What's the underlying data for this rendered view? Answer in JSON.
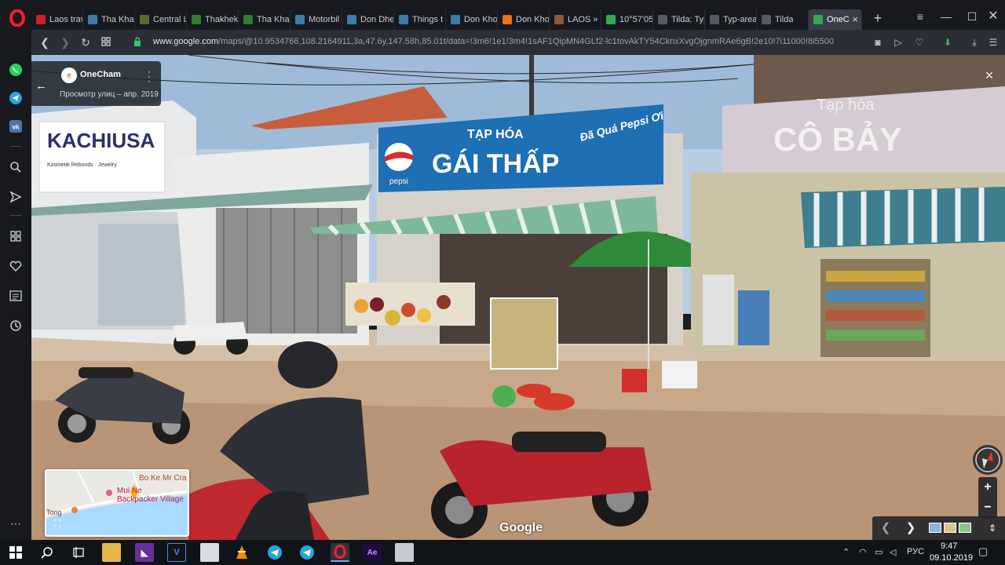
{
  "browser": {
    "tabs": [
      {
        "label": "Laos trav",
        "favicon": "opera-icon",
        "color": "#cc1f2f"
      },
      {
        "label": "Tha Khae",
        "favicon": "tripadvisor-icon",
        "color": "#3d7ea6"
      },
      {
        "label": "Central L",
        "favicon": "dm-icon",
        "color": "#5a6a2f"
      },
      {
        "label": "Thakhek",
        "favicon": "leaf-icon",
        "color": "#2e7d32"
      },
      {
        "label": "Tha Khae",
        "favicon": "leaf-icon",
        "color": "#2e7d32"
      },
      {
        "label": "Motorbil",
        "favicon": "tripadvisor-icon",
        "color": "#3d7ea6"
      },
      {
        "label": "Don Dhe",
        "favicon": "tripadvisor-icon",
        "color": "#3d7ea6"
      },
      {
        "label": "Things t",
        "favicon": "tripadvisor-icon",
        "color": "#3d7ea6"
      },
      {
        "label": "Don Kho",
        "favicon": "tripadvisor-icon",
        "color": "#3d7ea6"
      },
      {
        "label": "Don Kho",
        "favicon": "orange-circle-icon",
        "color": "#e8711a"
      },
      {
        "label": "LAOS » I",
        "favicon": "person-icon",
        "color": "#8e5a3a"
      },
      {
        "label": "10°57'05",
        "favicon": "google-maps-icon",
        "color": "#34a853"
      },
      {
        "label": "Tilda: Typ",
        "favicon": "tilda-icon",
        "color": "#555a63"
      },
      {
        "label": "Typ-area",
        "favicon": "tilda-icon",
        "color": "#555a63"
      },
      {
        "label": "Tilda",
        "favicon": "tilda-icon",
        "color": "#555a63"
      },
      {
        "label": "OneC",
        "favicon": "google-maps-icon",
        "color": "#34a853",
        "active": true
      }
    ],
    "new_tab": "+",
    "url_host": "www.google.com",
    "url_path": "/maps/@10.9534766,108.2164911,3a,47.6y,147.58h,85.01t/data=!3m6!1e1!3m4!1sAF1QipMN4GLf2-lc1tovAkTY54CknxXvgOjgnmRAe6gB!2e10!7i11000!8i5500"
  },
  "streetview": {
    "place_title": "OneCham",
    "place_subtitle": "Просмотр улиц – апр. 2019",
    "logo_letter": "e",
    "back_arrow": "←",
    "close": "×",
    "minimap": {
      "label_top": "Bo Ke Mr Cra",
      "label_place_1": "Mui Ne",
      "label_place_2": "Backpacker Village",
      "label_left": "Tong"
    },
    "google": "Google",
    "zoom_in": "+",
    "zoom_out": "−"
  },
  "scene": {
    "shop_left_1": "KACHIUSA",
    "shop_left_1_sub": "Kosmetik Rebonds · Jewelry",
    "shop_center_top": "TẠP HÓA",
    "shop_center_name": "GÁI THẤP",
    "shop_center_brand": "pepsi",
    "shop_center_slogan": "Đã Quá Pepsi Ơi",
    "shop_right_top": "Tạp hóa",
    "shop_right_name": "CÔ BẢY"
  },
  "taskbar": {
    "lang": "РУС",
    "time": "9:47",
    "date": "09.10.2019"
  },
  "colors": {
    "opera_red": "#ff1b2d",
    "sky": "#a9c3dd",
    "pepsi_blue": "#1e6fb3"
  }
}
